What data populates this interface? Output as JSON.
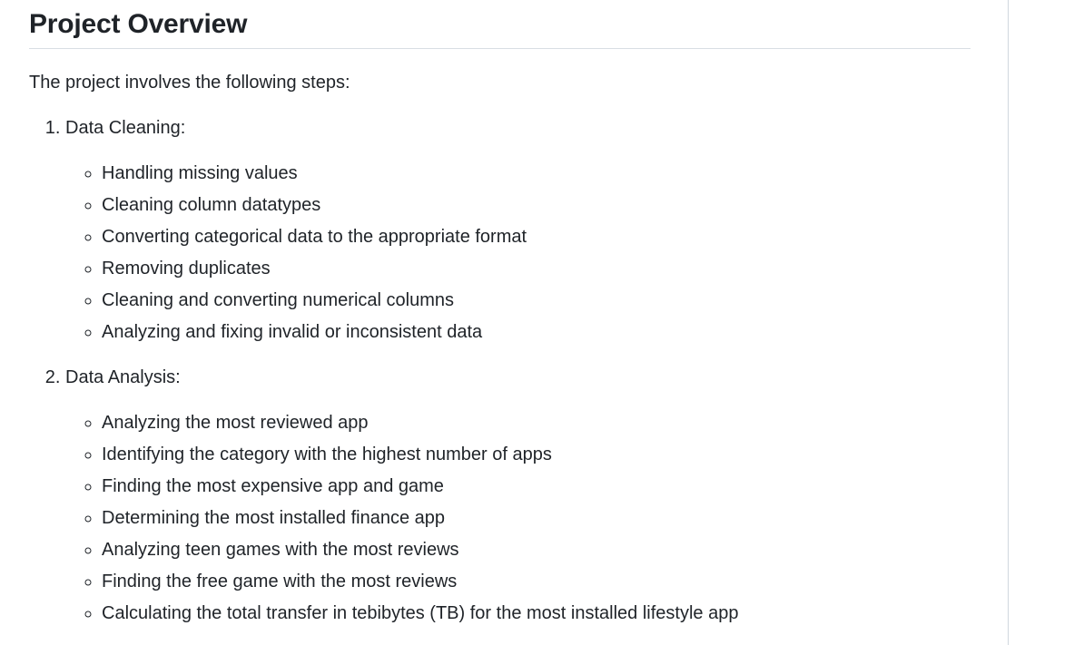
{
  "heading": "Project Overview",
  "intro": "The project involves the following steps:",
  "steps": [
    {
      "label": "Data Cleaning:",
      "items": [
        "Handling missing values",
        "Cleaning column datatypes",
        "Converting categorical data to the appropriate format",
        "Removing duplicates",
        "Cleaning and converting numerical columns",
        "Analyzing and fixing invalid or inconsistent data"
      ]
    },
    {
      "label": "Data Analysis:",
      "items": [
        "Analyzing the most reviewed app",
        "Identifying the category with the highest number of apps",
        "Finding the most expensive app and game",
        "Determining the most installed finance app",
        "Analyzing teen games with the most reviews",
        "Finding the free game with the most reviews",
        "Calculating the total transfer in tebibytes (TB) for the most installed lifestyle app"
      ]
    }
  ]
}
